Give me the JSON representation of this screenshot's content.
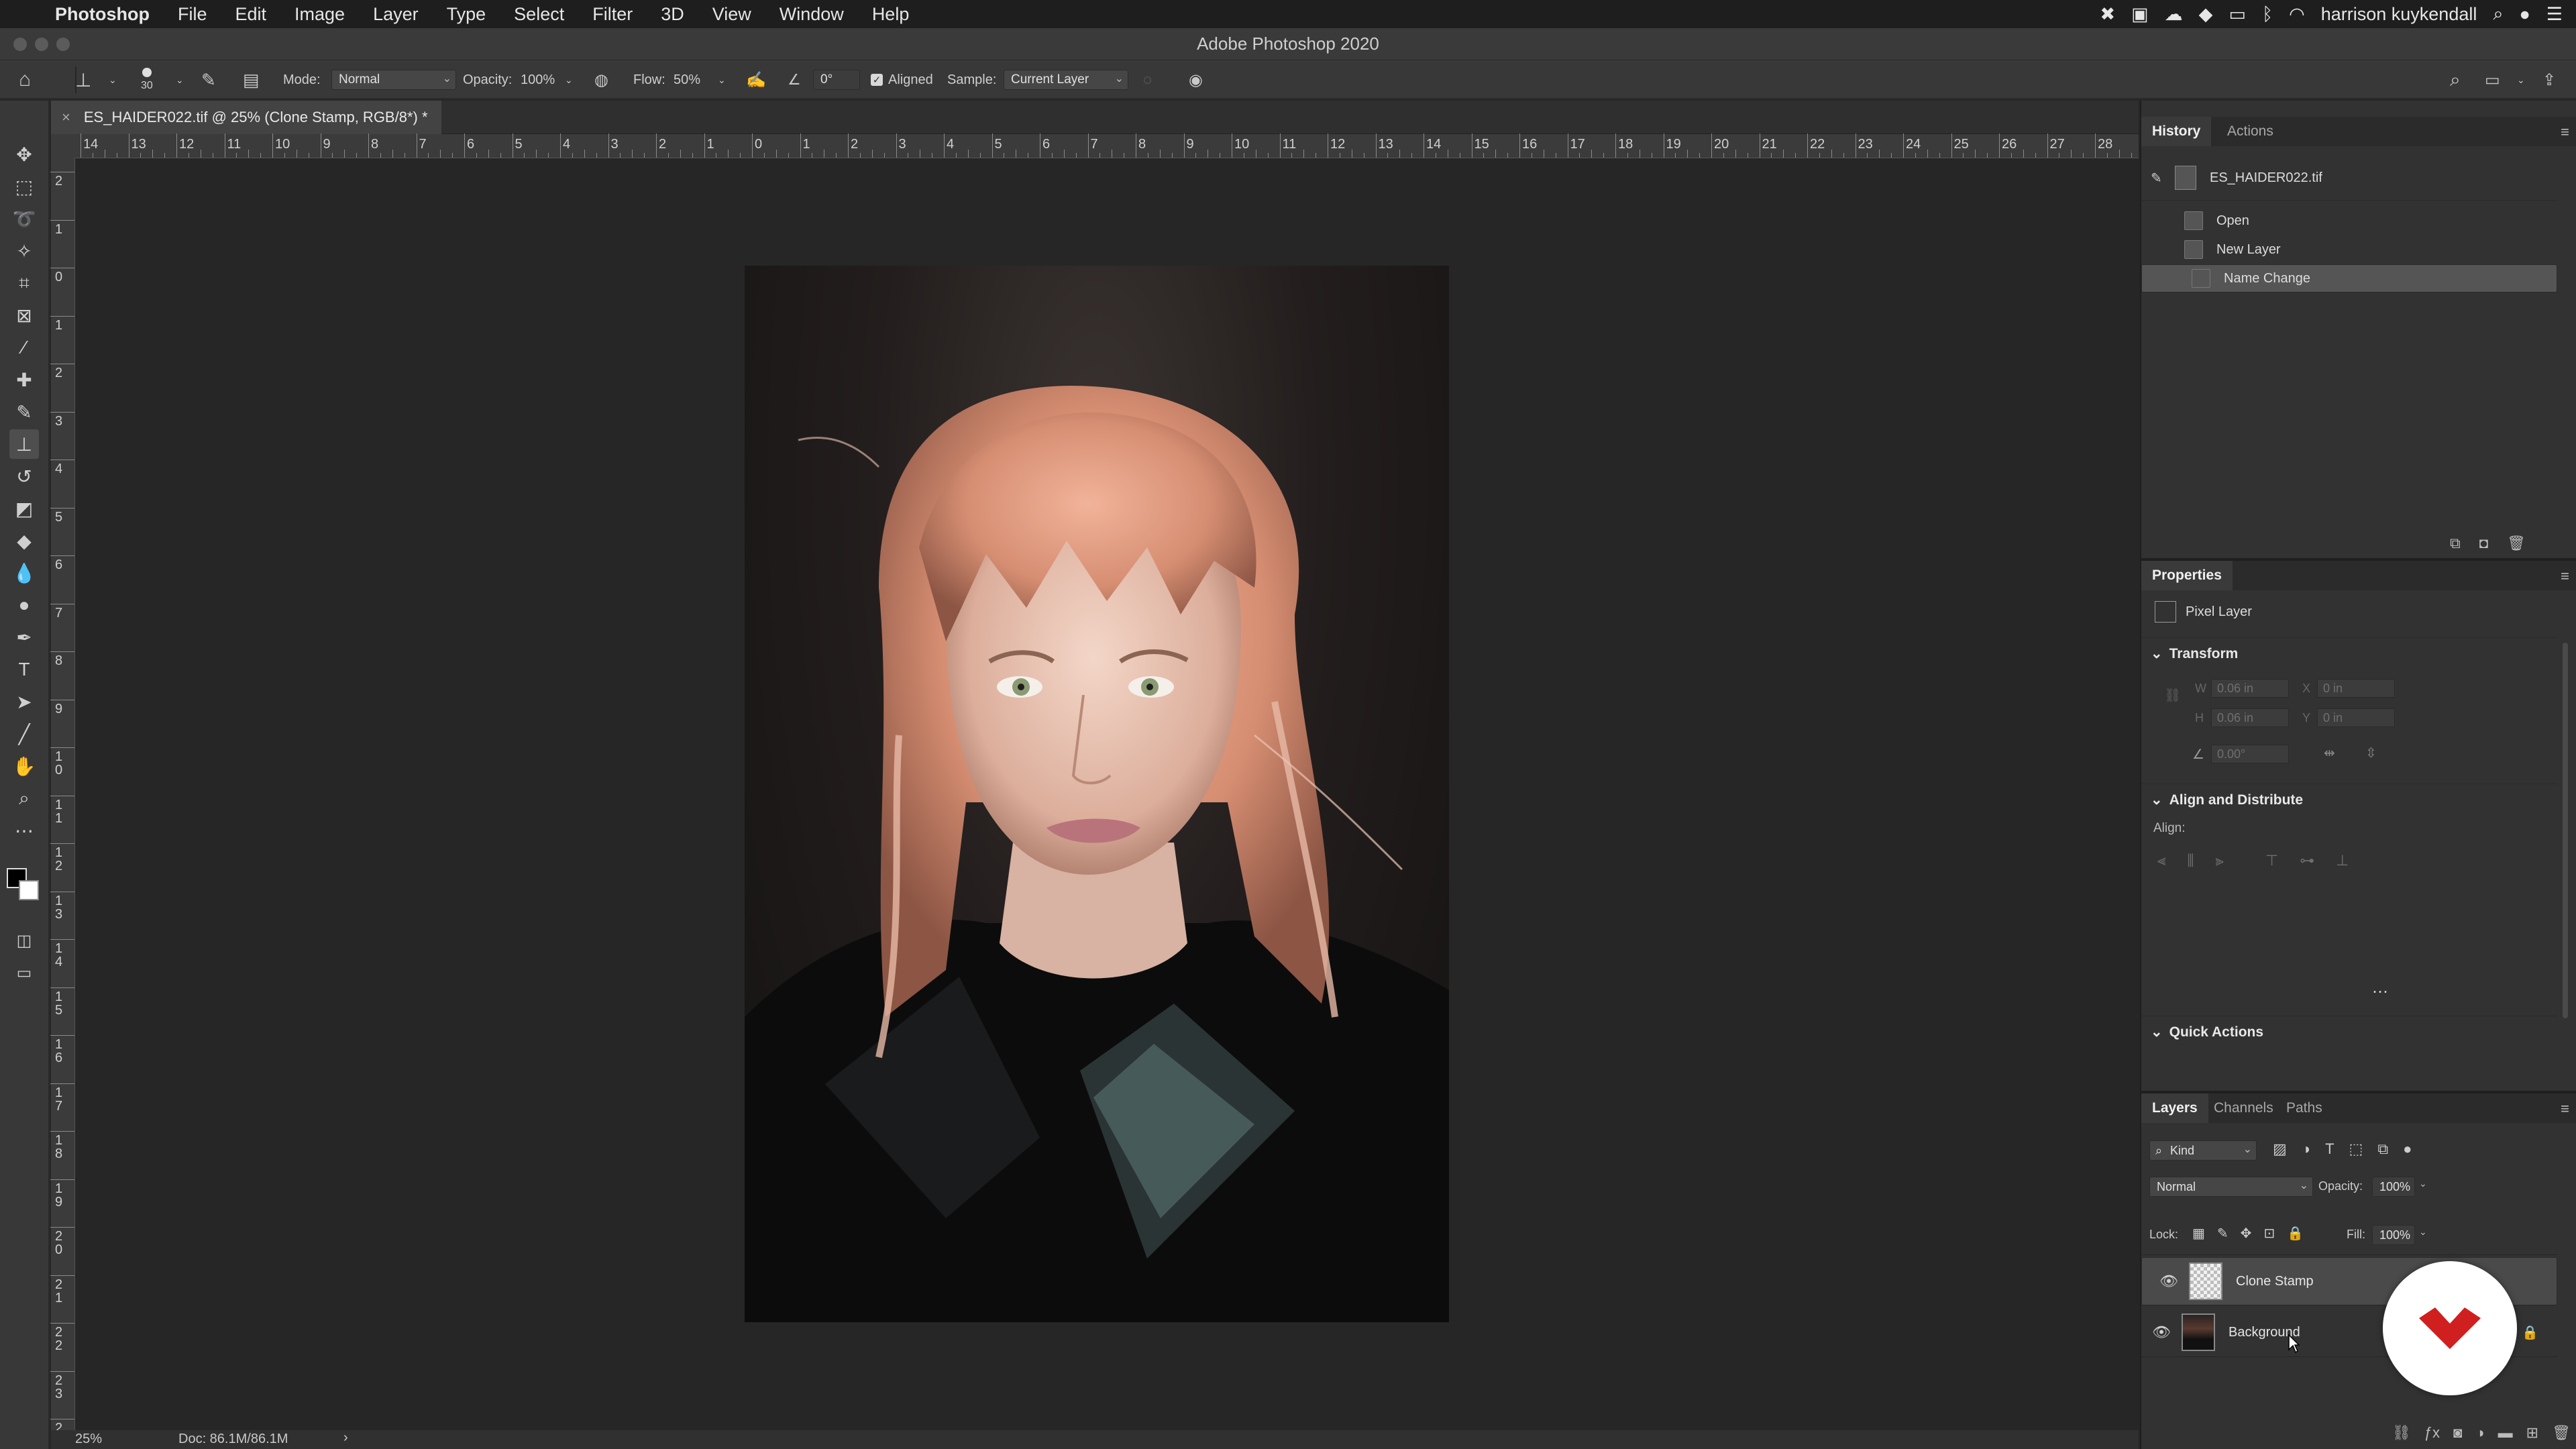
{
  "menubar": {
    "app_name": "Photoshop",
    "items": [
      "File",
      "Edit",
      "Image",
      "Layer",
      "Type",
      "Select",
      "Filter",
      "3D",
      "View",
      "Window",
      "Help"
    ],
    "user": "harrison kuykendall"
  },
  "window": {
    "title": "Adobe Photoshop 2020"
  },
  "options_bar": {
    "brush_size": "30",
    "mode_label": "Mode:",
    "mode_value": "Normal",
    "opacity_label": "Opacity:",
    "opacity_value": "100%",
    "flow_label": "Flow:",
    "flow_value": "50%",
    "angle_value": "0°",
    "aligned_label": "Aligned",
    "aligned_checked": true,
    "sample_label": "Sample:",
    "sample_value": "Current Layer"
  },
  "document": {
    "tab_title": "ES_HAIDER022.tif @ 25% (Clone Stamp, RGB/8*) *",
    "zoom": "25%",
    "doc_size": "Doc: 86.1M/86.1M"
  },
  "ruler": {
    "h_labels": [
      "14",
      "13",
      "12",
      "11",
      "10",
      "9",
      "8",
      "7",
      "6",
      "5",
      "4",
      "3",
      "2",
      "1",
      "0",
      "1",
      "2",
      "3",
      "4",
      "5",
      "6",
      "7",
      "8",
      "9",
      "10",
      "11",
      "12",
      "13",
      "14",
      "15",
      "16",
      "17",
      "18",
      "19",
      "20",
      "21",
      "22",
      "23",
      "24",
      "25",
      "26",
      "27",
      "28"
    ],
    "v_labels": [
      "2",
      "1",
      "0",
      "1",
      "2",
      "3",
      "4",
      "5",
      "6",
      "7",
      "8",
      "9",
      "1\n0",
      "1\n1",
      "1\n2",
      "1\n3",
      "1\n4",
      "1\n5",
      "1\n6",
      "1\n7",
      "1\n8",
      "1\n9",
      "2\n0",
      "2\n1",
      "2\n2",
      "2\n3",
      "2\n4"
    ]
  },
  "history": {
    "tabs": [
      "History",
      "Actions"
    ],
    "snapshot": "ES_HAIDER022.tif",
    "steps": [
      "Open",
      "New Layer",
      "Name Change"
    ],
    "selected_step": "Name Change"
  },
  "properties": {
    "title": "Properties",
    "layer_type": "Pixel Layer",
    "transform_label": "Transform",
    "w_label": "W",
    "w_value": "0.06 in",
    "h_label": "H",
    "h_value": "0.06 in",
    "x_label": "X",
    "x_value": "0 in",
    "y_label": "Y",
    "y_value": "0 in",
    "angle_value": "0.00°",
    "align_label": "Align and Distribute",
    "align_sub": "Align:",
    "quick_label": "Quick Actions"
  },
  "layers": {
    "tabs": [
      "Layers",
      "Channels",
      "Paths"
    ],
    "filter": "Kind",
    "blend": "Normal",
    "opacity_label": "Opacity:",
    "opacity_value": "100%",
    "lock_label": "Lock:",
    "fill_label": "Fill:",
    "fill_value": "100%",
    "items": [
      {
        "name": "Clone Stamp",
        "selected": true
      },
      {
        "name": "Background",
        "selected": false
      }
    ]
  },
  "colors": {
    "accent_logo": "#d01f1f",
    "panel_bg": "#323232"
  }
}
